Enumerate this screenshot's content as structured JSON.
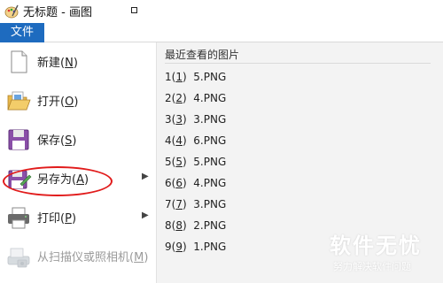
{
  "window": {
    "title": "无标题 - 画图"
  },
  "ribbon": {
    "file_tab": "文件"
  },
  "menu": {
    "items": [
      {
        "label": "新建",
        "key": "N",
        "icon": "new-file-icon"
      },
      {
        "label": "打开",
        "key": "O",
        "icon": "open-folder-icon"
      },
      {
        "label": "保存",
        "key": "S",
        "icon": "floppy-disk-icon"
      },
      {
        "label": "另存为",
        "key": "A",
        "icon": "save-as-icon",
        "submenu": true
      },
      {
        "label": "打印",
        "key": "P",
        "icon": "printer-icon",
        "submenu": true
      },
      {
        "label": "从扫描仪或照相机",
        "key": "M",
        "icon": "scanner-icon",
        "disabled": true
      }
    ],
    "highlight_color": "#e11b1b"
  },
  "recent": {
    "title": "最近查看的图片",
    "files": [
      {
        "num": "1",
        "key": "1",
        "name": "5.PNG"
      },
      {
        "num": "2",
        "key": "2",
        "name": "4.PNG"
      },
      {
        "num": "3",
        "key": "3",
        "name": "3.PNG"
      },
      {
        "num": "4",
        "key": "4",
        "name": "6.PNG"
      },
      {
        "num": "5",
        "key": "5",
        "name": "5.PNG"
      },
      {
        "num": "6",
        "key": "6",
        "name": "4.PNG"
      },
      {
        "num": "7",
        "key": "7",
        "name": "3.PNG"
      },
      {
        "num": "8",
        "key": "8",
        "name": "2.PNG"
      },
      {
        "num": "9",
        "key": "9",
        "name": "1.PNG"
      }
    ]
  },
  "watermark": {
    "main": "软件无忧",
    "sub": "努力解决软件问题"
  },
  "colors": {
    "accent": "#1e6bbf",
    "recent_bg": "#f3f3f3"
  }
}
